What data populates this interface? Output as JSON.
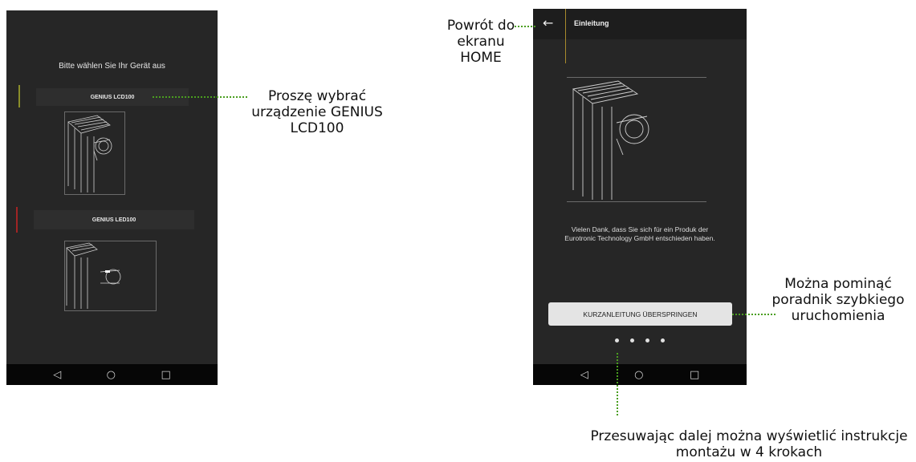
{
  "left_screen": {
    "title": "Bitte wählen Sie Ihr Gerät aus",
    "devices": [
      {
        "label": "GENIUS LCD100",
        "accent_color": "#8a8d2a"
      },
      {
        "label": "GENIUS LED100",
        "accent_color": "#a12424"
      }
    ]
  },
  "right_screen": {
    "back_icon": "←",
    "title": "Einleitung",
    "welcome_text": "Vielen Dank, dass Sie sich für ein Produk der Eurotronic Technology GmbH entschieden haben.",
    "skip_button": "KURZANLEITUNG ÜBERSPRINGEN",
    "page_dots": 4
  },
  "navbar": {
    "back": "◁",
    "home": "○",
    "recents": "□"
  },
  "annotations": {
    "select_device": "Proszę wybrać urządzenie GENIUS LCD100",
    "back_home": "Powrót do ekranu HOME",
    "skip_tutorial": "Można pominąć poradnik szybkiego uruchomienia",
    "swipe_steps": "Przesuwając dalej można wyświetlić instrukcje montażu w 4 krokach"
  },
  "colors": {
    "leader_line": "#4a9e1f",
    "phone_bg": "#262626"
  }
}
